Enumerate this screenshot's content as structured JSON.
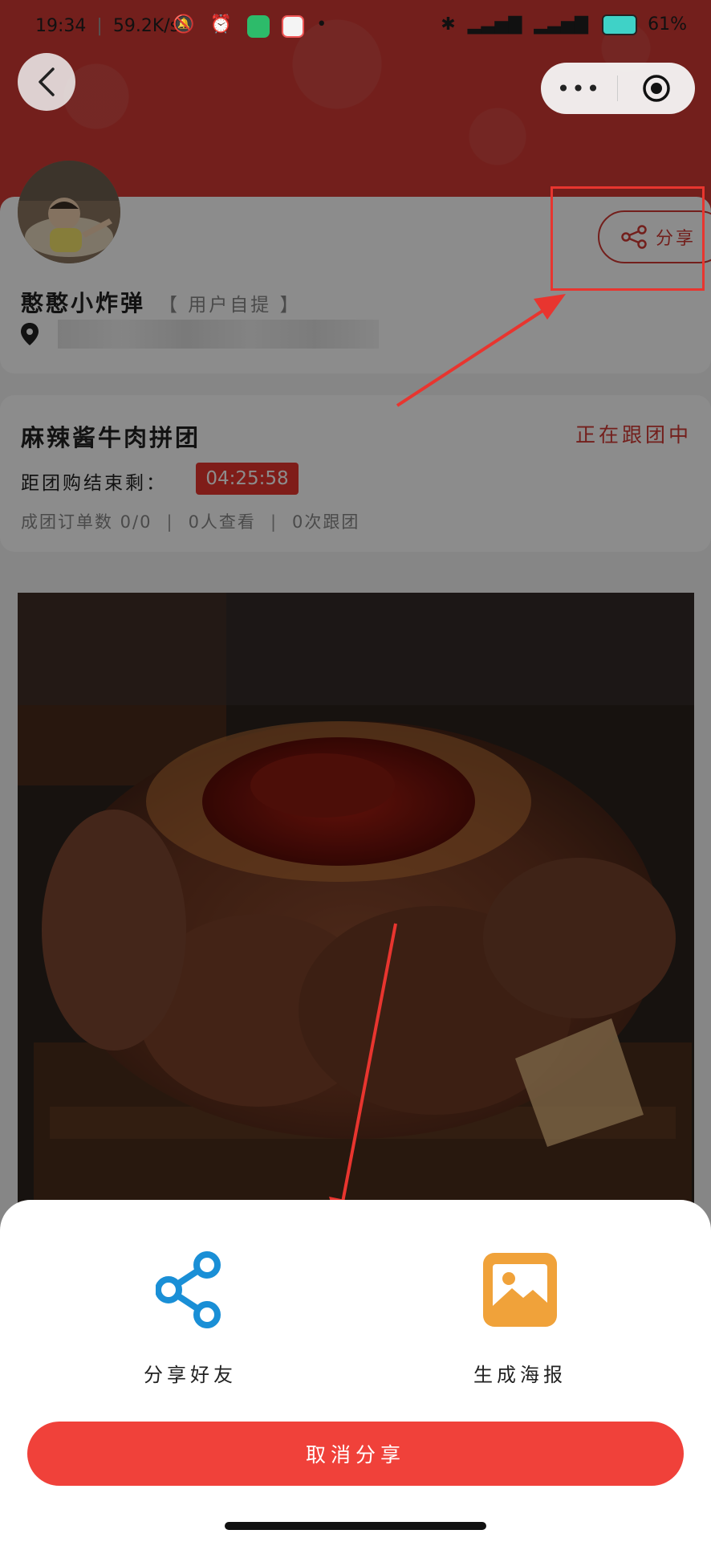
{
  "status_bar": {
    "time": "19:34",
    "speed": "59.2K/s",
    "battery": "61%",
    "right_icons": [
      "bluetooth-icon",
      "signal-4g-icon",
      "signal-4g-icon",
      "battery-icon"
    ]
  },
  "header": {
    "back_icon": "chevron-left-icon",
    "capsule_more": "•••",
    "capsule_close_icon": "target-icon",
    "colors": {
      "header_red": "#d13a34"
    }
  },
  "profile": {
    "name": "憨憨小炸弹",
    "pickup_tag": "【 用户自提 】",
    "location_icon": "map-pin-icon",
    "share_label": "分享"
  },
  "group": {
    "title": "麻辣酱牛肉拼团",
    "status": "正在跟团中",
    "countdown_label": "距团购结束剩：",
    "countdown": "04:25:58",
    "stats": [
      "成团订单数 0/0",
      "0人查看",
      "0次跟团"
    ]
  },
  "share_sheet": {
    "options": [
      {
        "label": "分享好友",
        "icon": "share-icon",
        "color": "#1a8fd6"
      },
      {
        "label": "生成海报",
        "icon": "image-icon",
        "color": "#f0a23a"
      }
    ],
    "cancel_label": "取消分享",
    "colors": {
      "cancel_red": "#f0413a"
    }
  }
}
